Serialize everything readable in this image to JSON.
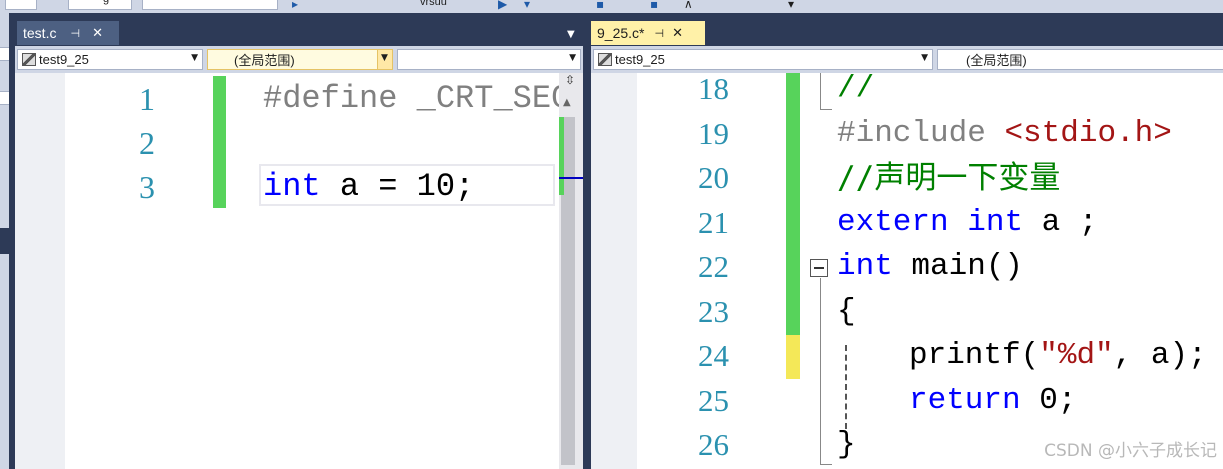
{
  "toolbar": {
    "field1_text": "g",
    "field2_text": "",
    "label_frag": "vrsuu"
  },
  "left_pane": {
    "tab": {
      "label": "test.c",
      "pin": "⊣",
      "close": "✕"
    },
    "nav": {
      "project": "test9_25",
      "scope": "(全局范围)",
      "member": ""
    },
    "lines": [
      {
        "num": "1",
        "code": "#define _CRT_SECU"
      },
      {
        "num": "2",
        "code": ""
      },
      {
        "num": "3",
        "code_kw": "int",
        "code_rest": " a = 10;"
      }
    ]
  },
  "right_pane": {
    "tab": {
      "label": "9_25.c*",
      "pin": "⊣",
      "close": "✕"
    },
    "nav": {
      "project": "test9_25",
      "scope": "(全局范围)"
    },
    "lines": [
      {
        "num": "18",
        "text": "//"
      },
      {
        "num": "19",
        "pp": "#include ",
        "str": "<stdio.h>"
      },
      {
        "num": "20",
        "text": "//声明一下变量"
      },
      {
        "num": "21",
        "kw1": "extern",
        "sp": " ",
        "kw2": "int",
        "rest": " a ;"
      },
      {
        "num": "22",
        "kw": "int",
        "rest": " main()"
      },
      {
        "num": "23",
        "text": "{"
      },
      {
        "num": "24",
        "a": "printf(",
        "str": "\"%d\"",
        "b": ", a);"
      },
      {
        "num": "25",
        "kw": "return",
        "rest": " 0;"
      },
      {
        "num": "26",
        "text": "}"
      }
    ]
  },
  "watermark": "CSDN @小六子成长记"
}
